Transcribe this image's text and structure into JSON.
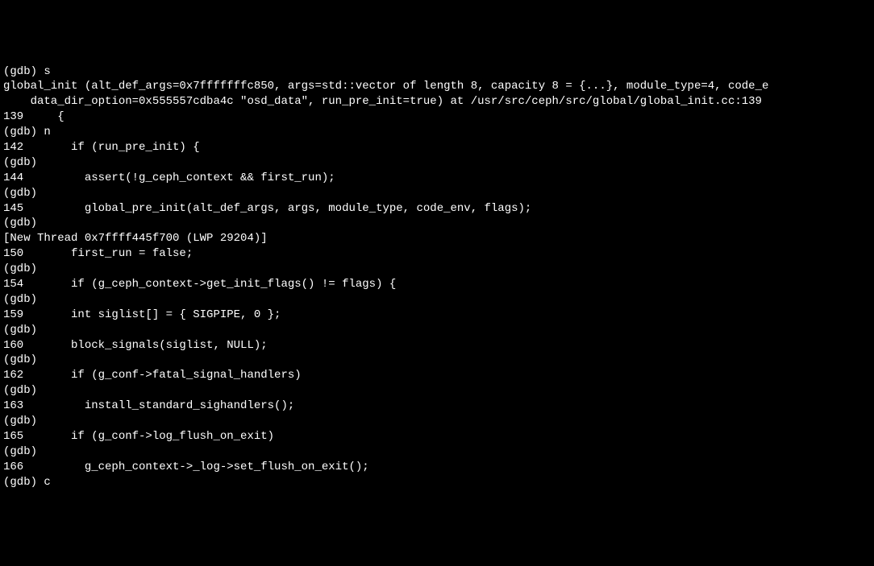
{
  "lines": [
    {
      "text": "(gdb) s"
    },
    {
      "text": "global_init (alt_def_args=0x7fffffffc850, args=std::vector of length 8, capacity 8 = {...}, module_type=4, code_e"
    },
    {
      "text": "    data_dir_option=0x555557cdba4c \"osd_data\", run_pre_init=true) at /usr/src/ceph/src/global/global_init.cc:139"
    },
    {
      "text": "139     {"
    },
    {
      "text": "(gdb) n"
    },
    {
      "text": "142       if (run_pre_init) {"
    },
    {
      "text": "(gdb)"
    },
    {
      "text": "144         assert(!g_ceph_context && first_run);"
    },
    {
      "text": "(gdb)"
    },
    {
      "text": "145         global_pre_init(alt_def_args, args, module_type, code_env, flags);"
    },
    {
      "text": "(gdb)"
    },
    {
      "text": "[New Thread 0x7ffff445f700 (LWP 29204)]"
    },
    {
      "text": "150       first_run = false;"
    },
    {
      "text": "(gdb)"
    },
    {
      "text": "154       if (g_ceph_context->get_init_flags() != flags) {"
    },
    {
      "text": "(gdb)"
    },
    {
      "text": ""
    },
    {
      "text": "159       int siglist[] = { SIGPIPE, 0 };"
    },
    {
      "text": "(gdb)"
    },
    {
      "text": "160       block_signals(siglist, NULL);"
    },
    {
      "text": "(gdb)"
    },
    {
      "text": "162       if (g_conf->fatal_signal_handlers)"
    },
    {
      "text": "(gdb)"
    },
    {
      "text": "163         install_standard_sighandlers();"
    },
    {
      "text": "(gdb)"
    },
    {
      "text": "165       if (g_conf->log_flush_on_exit)"
    },
    {
      "text": "(gdb)"
    },
    {
      "text": "166         g_ceph_context->_log->set_flush_on_exit();"
    },
    {
      "text": "(gdb) c"
    }
  ]
}
